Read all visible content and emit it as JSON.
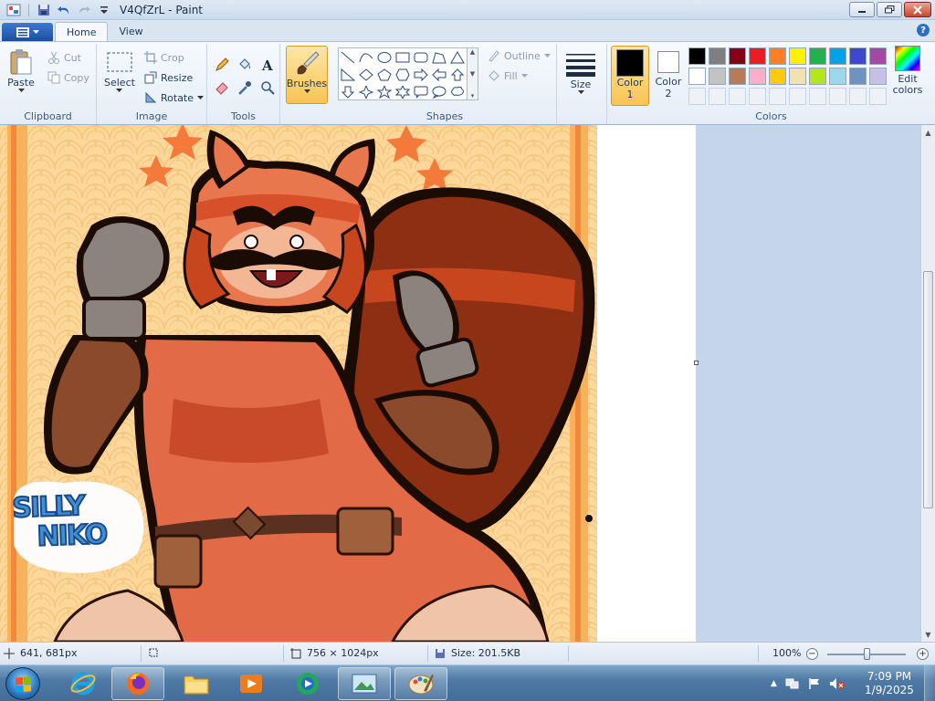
{
  "window": {
    "title": "V4QfZrL - Paint"
  },
  "tabs": {
    "home": "Home",
    "view": "View"
  },
  "ribbon": {
    "clipboard": {
      "label": "Clipboard",
      "paste": "Paste",
      "cut": "Cut",
      "copy": "Copy"
    },
    "image": {
      "label": "Image",
      "select": "Select",
      "crop": "Crop",
      "resize": "Resize",
      "rotate": "Rotate"
    },
    "tools": {
      "label": "Tools"
    },
    "brushes": {
      "label": "Brushes"
    },
    "shapes": {
      "label": "Shapes",
      "outline": "Outline",
      "fill": "Fill"
    },
    "size": {
      "label": "Size"
    },
    "colors": {
      "label": "Colors",
      "color1_label": "Color",
      "color1_num": "1",
      "color2_label": "Color",
      "color2_num": "2",
      "edit_label": "Edit colors",
      "color1_value": "#000000",
      "color2_value": "#ffffff",
      "palette": [
        "#000000",
        "#7f7f7f",
        "#880015",
        "#ed1c24",
        "#ff7f27",
        "#fff200",
        "#22b14c",
        "#00a2e8",
        "#3f48cc",
        "#a349a4",
        "#ffffff",
        "#c3c3c3",
        "#b97a57",
        "#ffaec9",
        "#ffc90e",
        "#efe4b0",
        "#b5e61d",
        "#99d9ea",
        "#7092be",
        "#c8bfe7"
      ]
    }
  },
  "artwork": {
    "logo_line1": "SILLY",
    "logo_line2": "NIKO"
  },
  "status": {
    "cursor": "641, 681px",
    "dimensions": "756 × 1024px",
    "size": "Size: 201.5KB",
    "zoom": "100%"
  },
  "taskbar": {
    "time": "7:09 PM",
    "date": "1/9/2025"
  }
}
